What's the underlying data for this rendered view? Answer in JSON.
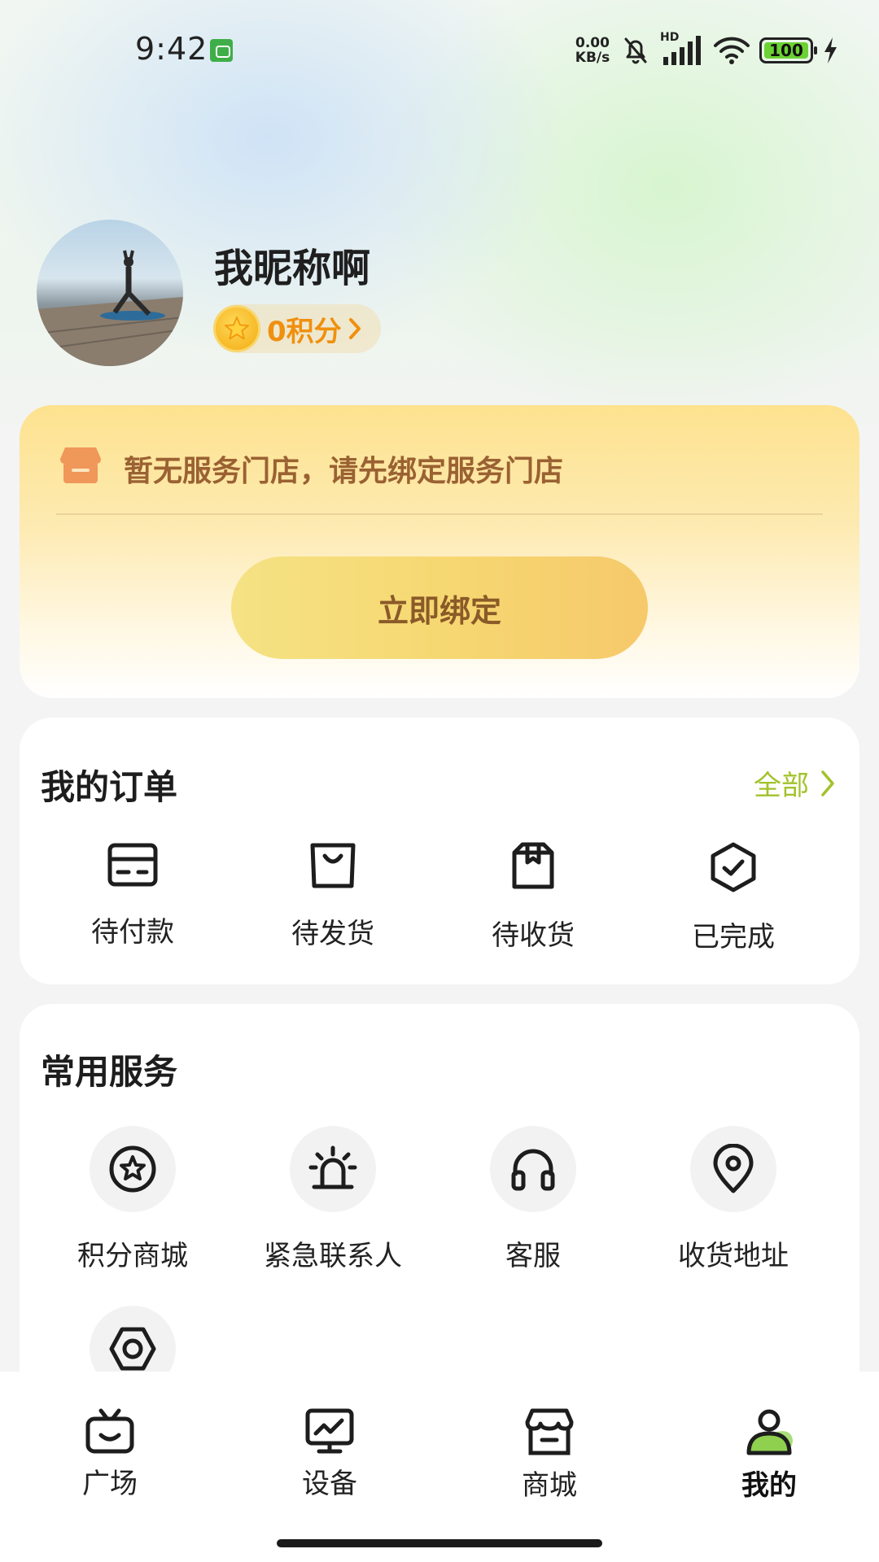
{
  "status_bar": {
    "time": "9:42",
    "net_speed_value": "0.00",
    "net_speed_unit": "KB/s",
    "signal_tag": "HD",
    "battery": "100"
  },
  "profile": {
    "nickname": "我昵称啊",
    "points_label": "0积分"
  },
  "store": {
    "message": "暂无服务门店，请先绑定服务门店",
    "bind_button": "立即绑定"
  },
  "orders": {
    "title": "我的订单",
    "see_all": "全部",
    "items": [
      {
        "label": "待付款",
        "icon": "card-icon"
      },
      {
        "label": "待发货",
        "icon": "bag-icon"
      },
      {
        "label": "待收货",
        "icon": "package-icon"
      },
      {
        "label": "已完成",
        "icon": "check-badge-icon"
      }
    ]
  },
  "services": {
    "title": "常用服务",
    "items": [
      {
        "label": "积分商城",
        "icon": "star-icon"
      },
      {
        "label": "紧急联系人",
        "icon": "alarm-icon"
      },
      {
        "label": "客服",
        "icon": "headphones-icon"
      },
      {
        "label": "收货地址",
        "icon": "location-pin-icon"
      },
      {
        "label": "",
        "icon": "hex-nut-icon"
      }
    ]
  },
  "bottom_nav": {
    "items": [
      {
        "label": "广场",
        "icon": "tv-icon"
      },
      {
        "label": "设备",
        "icon": "monitor-icon"
      },
      {
        "label": "商城",
        "icon": "store-icon"
      },
      {
        "label": "我的",
        "icon": "person-icon",
        "active": true
      }
    ]
  },
  "colors": {
    "accent_green": "#a2c22a",
    "points_orange": "#f0900f",
    "store_text_brown": "#9a6132",
    "bind_button_yellow": "#f6d872"
  }
}
